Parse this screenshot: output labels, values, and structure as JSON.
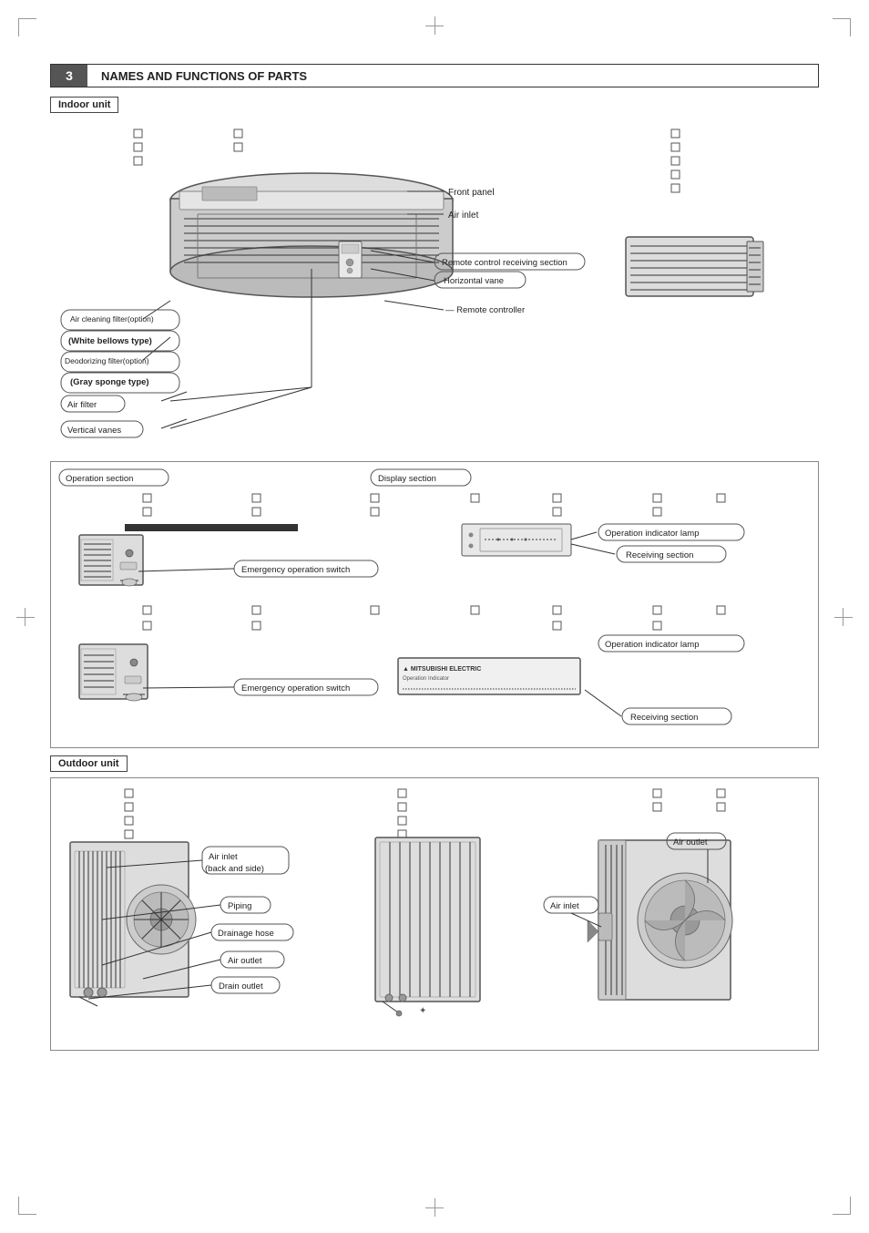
{
  "page": {
    "section_number": "3",
    "section_title": "NAMES AND FUNCTIONS OF PARTS",
    "indoor_label": "Indoor unit",
    "display_section_label": "Display section",
    "operation_section_label": "Operation section",
    "outdoor_label": "Outdoor unit",
    "parts": {
      "front_panel": "Front panel",
      "air_inlet": "Air inlet",
      "air_filter": "Air filter",
      "horizontal_vane": "Horizontal vane",
      "vertical_vanes": "Vertical vanes",
      "remote_controller": "Remote controller",
      "remote_control_receiving": "Remote control receiving section",
      "air_cleaning_filter": "Air cleaning filter(option)\n(White bellows type)",
      "deodorizing_filter": "Deodorizing filter(option)\n(Gray sponge type)",
      "operation_indicator_lamp": "Operation indicator lamp",
      "receiving_section": "Receiving section",
      "emergency_operation_switch": "Emergency operation switch",
      "air_inlet_back_side": "Air inlet\n(back and side)",
      "piping": "Piping",
      "drainage_hose": "Drainage hose",
      "air_outlet_indoor": "Air outlet",
      "drain_outlet": "Drain outlet",
      "air_inlet_outdoor": "Air inlet",
      "air_outlet_outdoor": "Air outlet"
    }
  }
}
